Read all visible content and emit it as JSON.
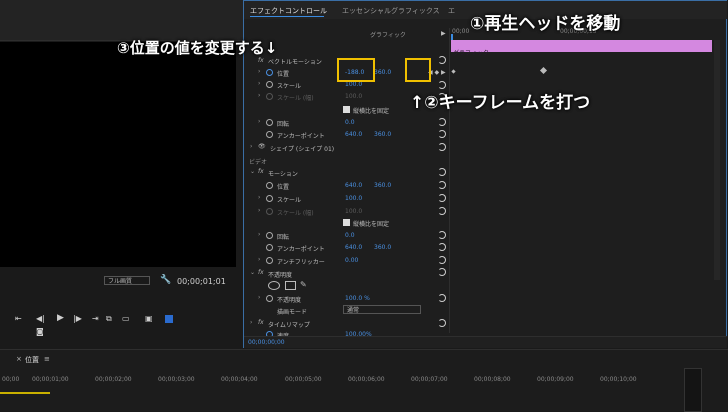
{
  "panel": {
    "tab_active": "エフェクトコントロール",
    "tab_2": "エッセンシャルグラフィックス",
    "tab_3": "エ",
    "clip_name": "グラフィック",
    "timecode_top_start": "00;00",
    "timecode_top_mid": "00;00;00;15",
    "bottom_timecode": "00;00;00;00"
  },
  "vector_motion": {
    "title": "ベクトルモーション",
    "position_label": "位置",
    "position_x": "-188.0",
    "position_y": "360.0",
    "scale_label": "スケール",
    "scale_value": "100.0",
    "scale_w_label": "スケール (幅)",
    "scale_w_value": "100.0",
    "uniform_scale": "縦横比を固定",
    "rotation_label": "回転",
    "rotation_value": "0.0",
    "anchor_label": "アンカーポイント",
    "anchor_x": "640.0",
    "anchor_y": "360.0",
    "shape_label": "シェイプ (シェイプ 01)"
  },
  "video_section": "ビデオ",
  "motion": {
    "title": "モーション",
    "position_label": "位置",
    "position_x": "640.0",
    "position_y": "360.0",
    "scale_label": "スケール",
    "scale_value": "100.0",
    "scale_w_label": "スケール (幅)",
    "scale_w_value": "100.0",
    "uniform_scale": "縦横比を固定",
    "rotation_label": "回転",
    "rotation_value": "0.0",
    "anchor_label": "アンカーポイント",
    "anchor_x": "640.0",
    "anchor_y": "360.0",
    "flicker_label": "アンチフリッカー",
    "flicker_value": "0.00"
  },
  "opacity": {
    "title": "不透明度",
    "opacity_label": "不透明度",
    "opacity_value": "100.0 %",
    "blend_label": "描画モード",
    "blend_value": "通常"
  },
  "time_remap": {
    "title": "タイムリマップ",
    "speed_label": "速度",
    "speed_value": "100.00%"
  },
  "monitor": {
    "quality": "フル画質",
    "timecode": "00;00;01;01"
  },
  "timeline": {
    "tab_label": "位置",
    "ticks": [
      "00;00",
      "00;00;01;00",
      "00;00;02;00",
      "00;00;03;00",
      "00;00;04;00",
      "00;00;05;00",
      "00;00;06;00",
      "00;00;07;00",
      "00;00;08;00",
      "00;00;09;00",
      "00;00;10;00"
    ]
  },
  "annotations": {
    "step1": "①再生ヘッドを移動",
    "step2": "↑②キーフレームを打つ",
    "step3": "③位置の値を変更する↓"
  },
  "colors": {
    "clip": "#d488e0",
    "accent_blue": "#4a90e2",
    "highlight": "#f0c000"
  }
}
